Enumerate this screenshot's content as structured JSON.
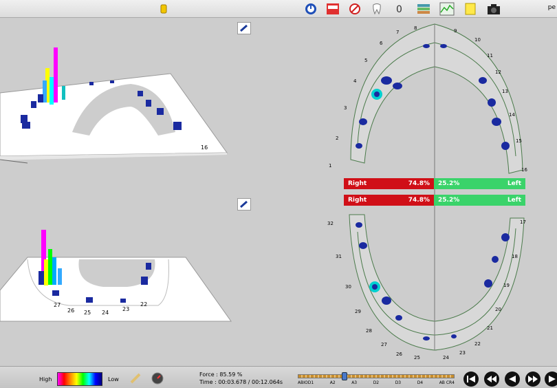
{
  "toolbar": {
    "left_label": "",
    "right_label": "pe",
    "icons": [
      "hand-icon",
      "timer-icon",
      "olea-icon",
      "stop-icon",
      "tooth-icon",
      "zero-icon",
      "layers-icon",
      "graph-icon",
      "note-icon",
      "camera-icon"
    ]
  },
  "arch": {
    "upper_numbers": [
      "8",
      "7",
      "6",
      "5",
      "4",
      "3",
      "2",
      "1",
      "9",
      "10",
      "11",
      "12",
      "13",
      "14",
      "15",
      "16"
    ],
    "lower_numbers": [
      "32",
      "31",
      "30",
      "29",
      "28",
      "27",
      "26",
      "25",
      "24",
      "23",
      "22",
      "21",
      "20",
      "19",
      "18",
      "17"
    ]
  },
  "balance_upper": {
    "right_label": "Right",
    "right_pct": "74.8%",
    "left_pct": "25.2%",
    "left_label": "Left"
  },
  "balance_lower": {
    "right_label": "Right",
    "right_pct": "74.8%",
    "left_pct": "25.2%",
    "left_label": "Left"
  },
  "bar3d_top": {
    "tooth_label": "16"
  },
  "bar3d_bottom": {
    "tooth_labels": [
      "27",
      "26",
      "25",
      "24",
      "23",
      "22"
    ]
  },
  "status": {
    "legend_high": "High",
    "legend_low": "Low",
    "force_label": "Force : 85.59 %",
    "time_label": "Time : 00:03.678 / 00:12.064s",
    "slider_value": 0.3,
    "slider_ticks": [
      "ABIOD1",
      "A2",
      "A3",
      "D2",
      "D3",
      "D4",
      "AB CR4"
    ]
  },
  "colors": {
    "balance_red": "#d00f17",
    "balance_green": "#3ad36a",
    "colorbar": [
      "#ff00ff",
      "#ff0000",
      "#ffff00",
      "#00ff00",
      "#00ffff",
      "#0000ff"
    ]
  }
}
